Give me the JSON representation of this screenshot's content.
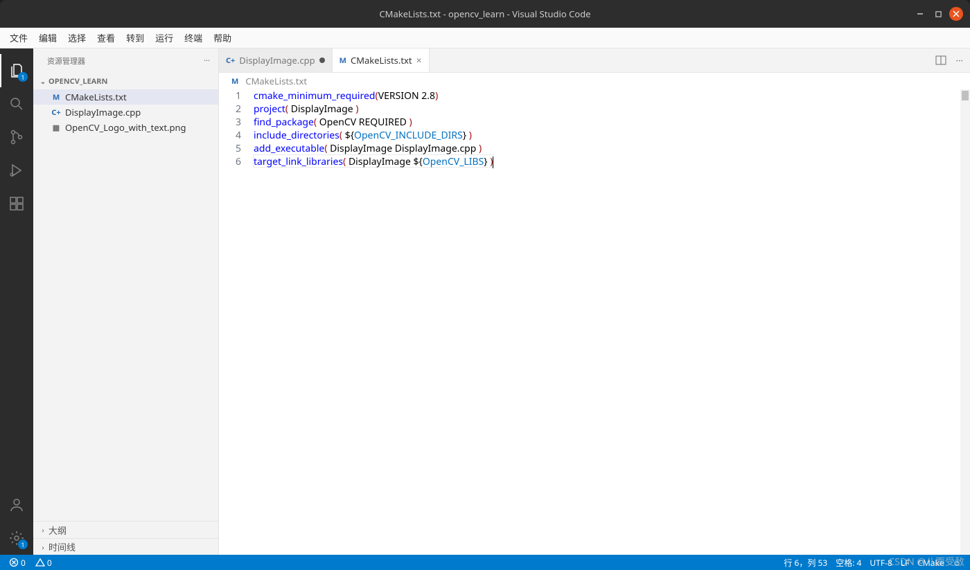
{
  "window": {
    "title": "CMakeLists.txt - opencv_learn - Visual Studio Code"
  },
  "menu": {
    "items": [
      "文件",
      "编辑",
      "选择",
      "查看",
      "转到",
      "运行",
      "终端",
      "帮助"
    ]
  },
  "activitybar": {
    "explorer_badge": "1",
    "settings_badge": "1"
  },
  "sidebar": {
    "header": "资源管理器",
    "section_title": "OPENCV_LEARN",
    "files": [
      {
        "name": "CMakeLists.txt",
        "icon": "cmake",
        "selected": true
      },
      {
        "name": "DisplayImage.cpp",
        "icon": "cpp",
        "selected": false
      },
      {
        "name": "OpenCV_Logo_with_text.png",
        "icon": "img",
        "selected": false
      }
    ],
    "outline": "大纲",
    "timeline": "时间线"
  },
  "tabs": [
    {
      "label": "DisplayImage.cpp",
      "icon": "cpp",
      "active": false,
      "dirty": true
    },
    {
      "label": "CMakeLists.txt",
      "icon": "cmake",
      "active": true,
      "dirty": false
    }
  ],
  "breadcrumbs": {
    "icon": "cmake",
    "text": "CMakeLists.txt"
  },
  "code": {
    "lines": [
      {
        "n": 1,
        "tokens": [
          {
            "t": "cmake_minimum_required",
            "c": "kw-func"
          },
          {
            "t": "(",
            "c": "kw-punct"
          },
          {
            "t": "VERSION 2.8",
            "c": "kw-txt"
          },
          {
            "t": ")",
            "c": "kw-punct"
          }
        ]
      },
      {
        "n": 2,
        "tokens": [
          {
            "t": "project",
            "c": "kw-func"
          },
          {
            "t": "( ",
            "c": "kw-punct"
          },
          {
            "t": "DisplayImage ",
            "c": "kw-txt"
          },
          {
            "t": ")",
            "c": "kw-punct"
          }
        ]
      },
      {
        "n": 3,
        "tokens": [
          {
            "t": "find_package",
            "c": "kw-func"
          },
          {
            "t": "( ",
            "c": "kw-punct"
          },
          {
            "t": "OpenCV REQUIRED ",
            "c": "kw-txt"
          },
          {
            "t": ")",
            "c": "kw-punct"
          }
        ]
      },
      {
        "n": 4,
        "tokens": [
          {
            "t": "include_directories",
            "c": "kw-func"
          },
          {
            "t": "( ",
            "c": "kw-punct"
          },
          {
            "t": "${",
            "c": "kw-txt"
          },
          {
            "t": "OpenCV_INCLUDE_DIRS",
            "c": "kw-var"
          },
          {
            "t": "}",
            "c": "kw-txt"
          },
          {
            "t": " )",
            "c": "kw-punct"
          }
        ]
      },
      {
        "n": 5,
        "tokens": [
          {
            "t": "add_executable",
            "c": "kw-func"
          },
          {
            "t": "( ",
            "c": "kw-punct"
          },
          {
            "t": "DisplayImage DisplayImage.cpp ",
            "c": "kw-txt"
          },
          {
            "t": ")",
            "c": "kw-punct"
          }
        ]
      },
      {
        "n": 6,
        "tokens": [
          {
            "t": "target_link_libraries",
            "c": "kw-func"
          },
          {
            "t": "( ",
            "c": "kw-punct"
          },
          {
            "t": "DisplayImage ",
            "c": "kw-txt"
          },
          {
            "t": "${",
            "c": "kw-txt"
          },
          {
            "t": "OpenCV_LIBS",
            "c": "kw-var"
          },
          {
            "t": "}",
            "c": "kw-txt"
          },
          {
            "t": " )",
            "c": "kw-punct"
          }
        ],
        "cursor": true
      }
    ]
  },
  "statusbar": {
    "errors": "0",
    "warnings": "0",
    "ln_col": "行 6，列 53",
    "spaces": "空格: 4",
    "encoding": "UTF-8",
    "eol": "LF",
    "lang": "CMake",
    "feedback": "☺"
  },
  "watermark": "CSDN @八面受敌"
}
